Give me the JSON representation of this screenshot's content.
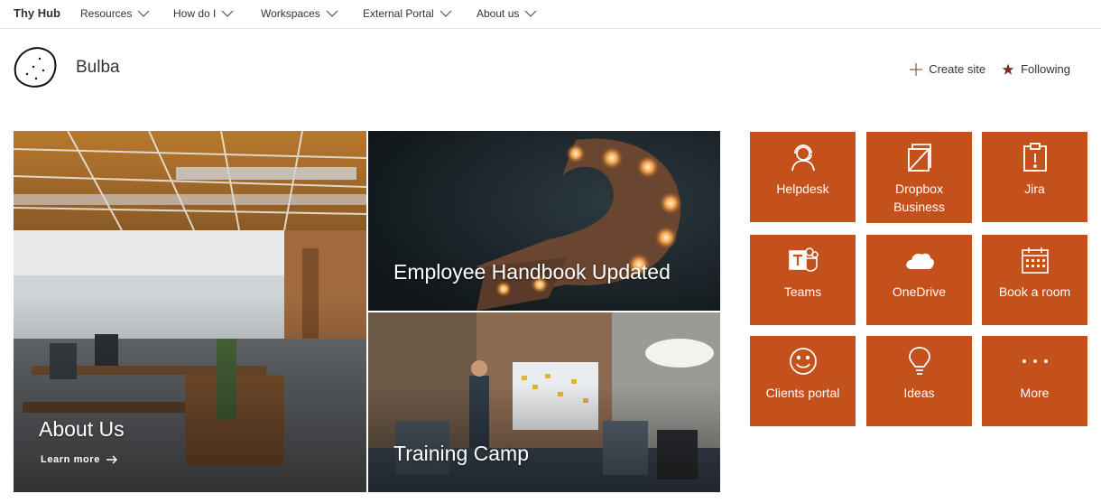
{
  "nav": {
    "brand": "Thy Hub",
    "items": [
      {
        "label": "Resources"
      },
      {
        "label": "How do I"
      },
      {
        "label": "Workspaces"
      },
      {
        "label": "External Portal"
      },
      {
        "label": "About us"
      }
    ]
  },
  "site": {
    "title": "Bulba",
    "logo_icon": "potato-icon"
  },
  "actions": {
    "create_label": "Create site",
    "following_label": "Following"
  },
  "hero": {
    "main": {
      "title": "About Us",
      "link": "Learn more"
    },
    "top_right": {
      "title": "Employee Handbook Updated"
    },
    "bottom_right": {
      "title": "Training Camp"
    }
  },
  "quick_links": [
    {
      "label": "Helpdesk",
      "icon": "headset-icon"
    },
    {
      "label": "Dropbox Business",
      "icon": "dropbox-icon"
    },
    {
      "label": "Jira",
      "icon": "clipboard-alert-icon"
    },
    {
      "label": "Teams",
      "icon": "teams-icon"
    },
    {
      "label": "OneDrive",
      "icon": "cloud-icon"
    },
    {
      "label": "Book a room",
      "icon": "calendar-icon"
    },
    {
      "label": "Clients portal",
      "icon": "smiley-icon"
    },
    {
      "label": "Ideas",
      "icon": "lightbulb-icon"
    },
    {
      "label": "More",
      "icon": "more-icon"
    }
  ],
  "colors": {
    "tile": "#c4501b",
    "following_star": "#7a2e14"
  }
}
